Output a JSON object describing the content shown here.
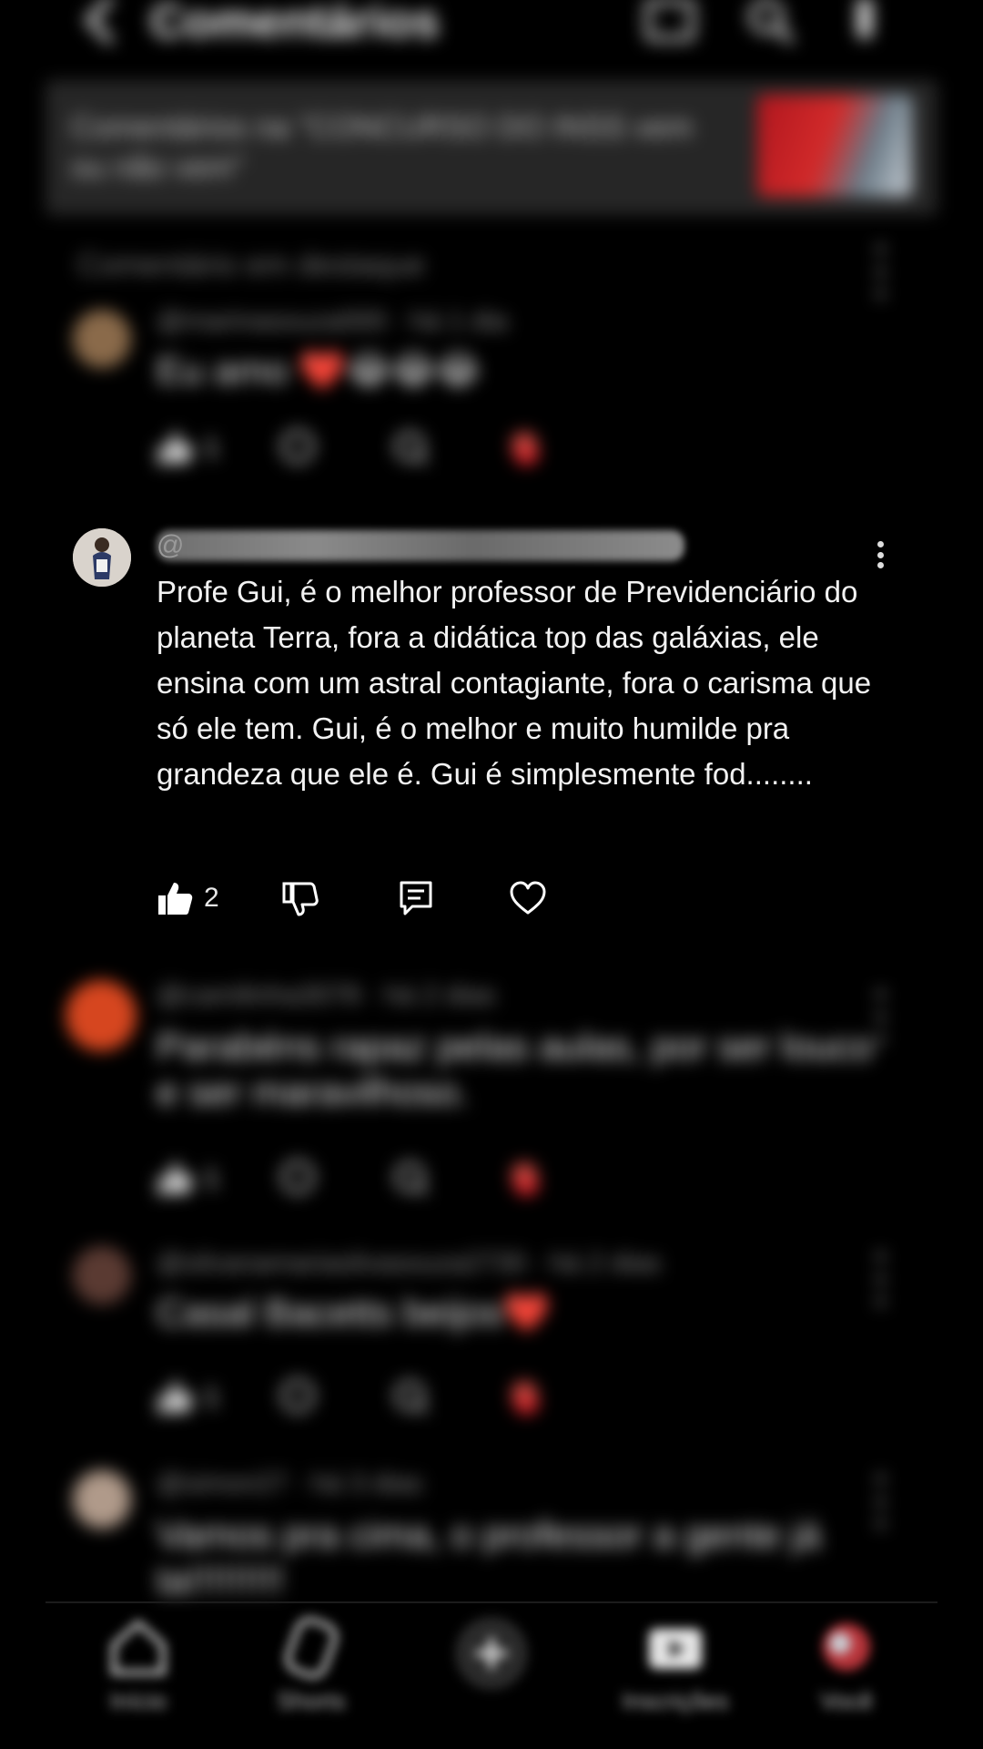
{
  "header": {
    "title": "Comentários",
    "icons": [
      "back-arrow-icon",
      "cast-icon",
      "search-icon",
      "more-vertical-icon"
    ]
  },
  "video": {
    "title": "Comentários na \"CONCURSO DO INSS vem ou não vem\""
  },
  "section_label": "Comentário em destaque",
  "comments": [
    {
      "handle": "@marinasouza000 · há 1 dia",
      "text": "Eu amo ❤️😂😂😂",
      "likes": "1"
    },
    {
      "handle_prefix": "@",
      "text": "Profe Gui, é o melhor professor de Previdenciário do planeta Terra, fora a didática top das galáxias, ele ensina com um astral contagiante, fora o carisma que só ele tem. Gui, é o melhor e muito humilde pra grandeza que ele é. Gui é simplesmente fod........",
      "likes": "2"
    },
    {
      "handle": "@camilinha3078 · há 2 dias",
      "text": "Parabéns rapaz pelas aulas, por ser louco e ser maravilhoso.",
      "likes": "1"
    },
    {
      "handle": "@silvanamariasilvasouza2730 · há 2 dias",
      "text": "Casal Bacetts beijos❤️",
      "likes": "1"
    },
    {
      "handle": "@simon27 · há 3 dias",
      "text": "Vamos pra cima, o professor a gente já ta!!!!!!!!!",
      "likes": ""
    }
  ],
  "bottom_nav": [
    {
      "label": "Início",
      "icon": "home-icon"
    },
    {
      "label": "Shorts",
      "icon": "shorts-icon"
    },
    {
      "label": "",
      "icon": "create-plus-icon"
    },
    {
      "label": "Inscrições",
      "icon": "subscriptions-icon"
    },
    {
      "label": "Você",
      "icon": "profile-avatar-icon"
    }
  ],
  "colors": {
    "background": "#000000",
    "text": "#f2f2f2",
    "muted": "#888888",
    "banner": "#262626",
    "accent_red": "#e0242b"
  }
}
